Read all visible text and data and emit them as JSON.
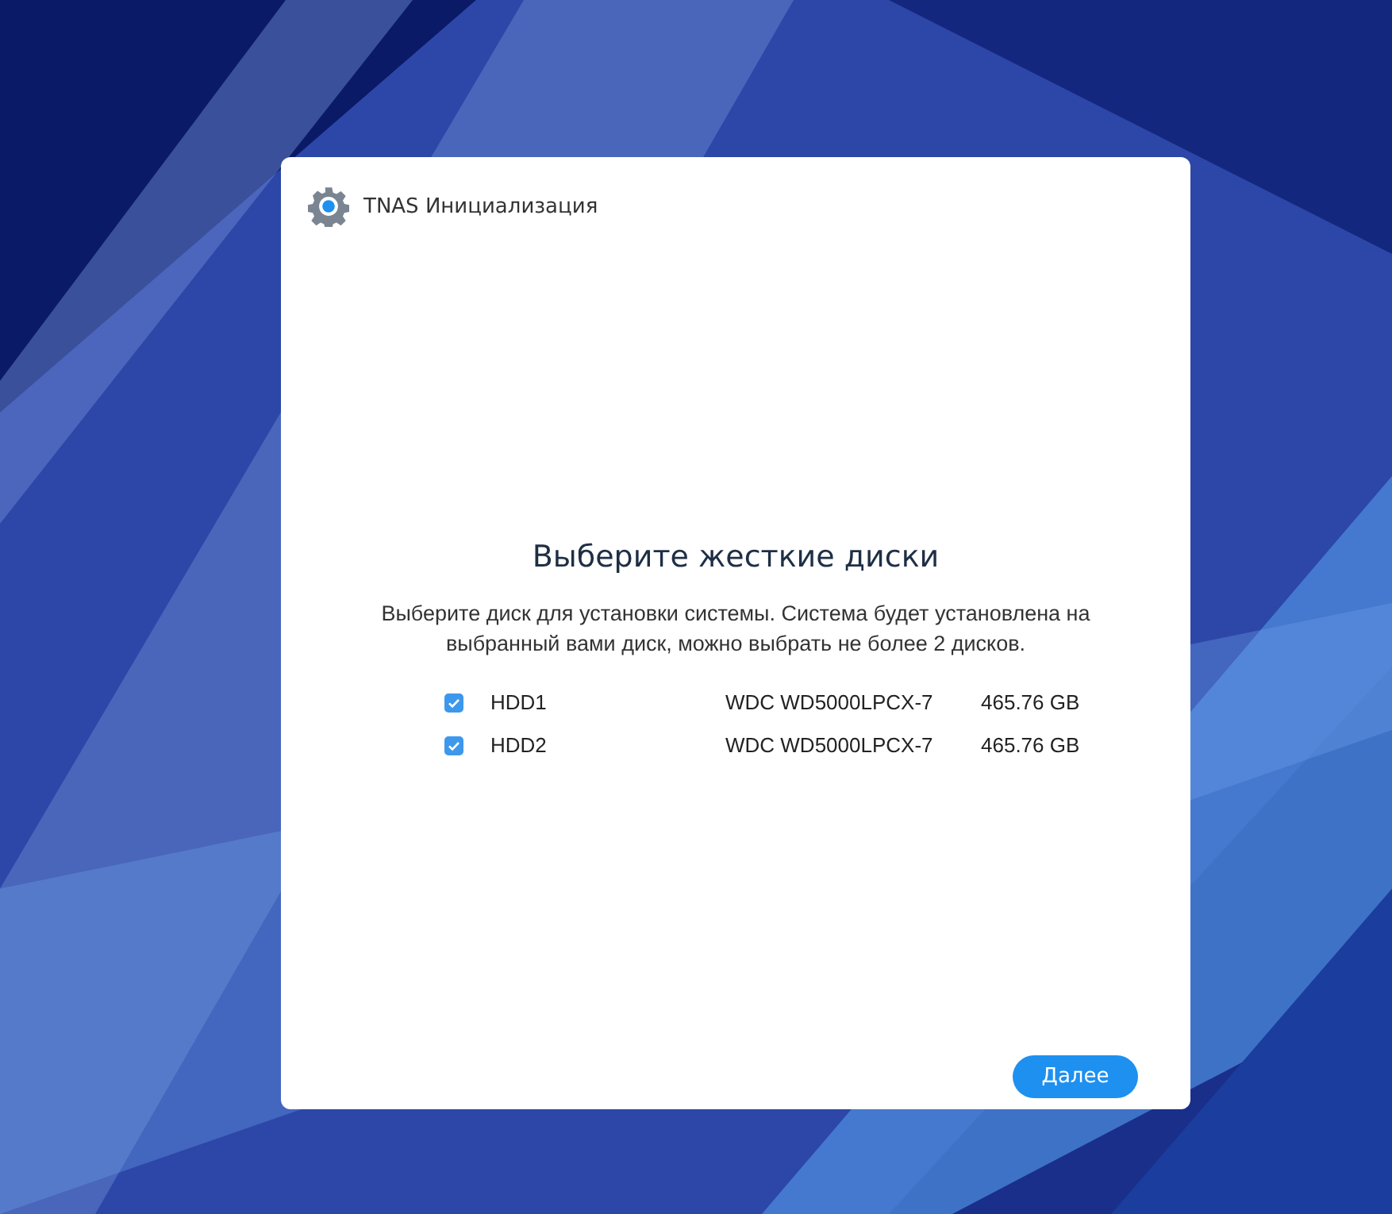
{
  "window": {
    "title": "TNAS Инициализация"
  },
  "heading": "Выберите жесткие диски",
  "description": "Выберите диск для установки системы. Система будет установлена на выбранный вами диск, можно выбрать не более 2 дисков.",
  "disks": [
    {
      "name": "HDD1",
      "model": "WDC WD5000LPCX-7",
      "size": "465.76 GB",
      "checked": true
    },
    {
      "name": "HDD2",
      "model": "WDC WD5000LPCX-7",
      "size": "465.76 GB",
      "checked": true
    }
  ],
  "buttons": [
    {
      "label": "Далее"
    }
  ]
}
